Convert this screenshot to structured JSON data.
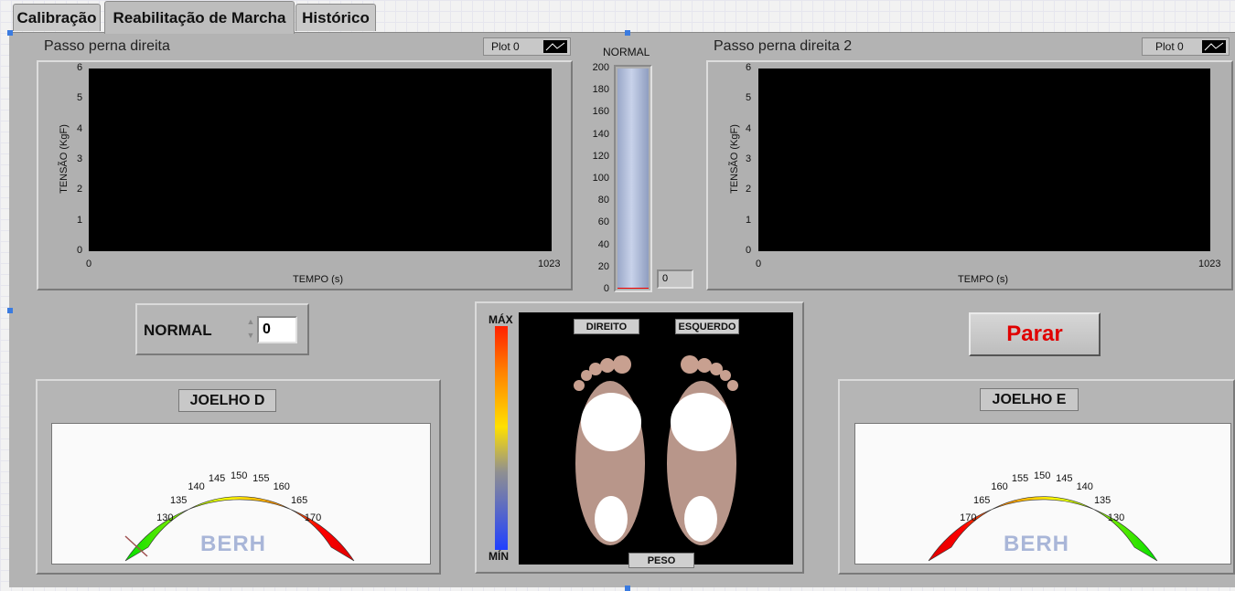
{
  "tabs": [
    {
      "label": "Calibração"
    },
    {
      "label": "Reabilitação de Marcha"
    },
    {
      "label": "Histórico"
    }
  ],
  "chart_left": {
    "title": "Passo perna direita",
    "legend": "Plot 0",
    "ylabel": "TENSÃO (KgF)",
    "xlabel": "TEMPO (s)",
    "y_ticks": [
      "6",
      "5",
      "4",
      "3",
      "2",
      "1",
      "0"
    ],
    "x_ticks": [
      "0",
      "1023"
    ]
  },
  "chart_right": {
    "title": "Passo perna direita 2",
    "legend": "Plot 0",
    "ylabel": "TENSÃO (KgF)",
    "xlabel": "TEMPO (s)",
    "y_ticks": [
      "6",
      "5",
      "4",
      "3",
      "2",
      "1",
      "0"
    ],
    "x_ticks": [
      "0",
      "1023"
    ]
  },
  "chart_data": [
    {
      "type": "line",
      "title": "Passo perna direita",
      "xlabel": "TEMPO (s)",
      "ylabel": "TENSÃO (KgF)",
      "xlim": [
        0,
        1023
      ],
      "ylim": [
        0,
        6
      ],
      "series": []
    },
    {
      "type": "line",
      "title": "Passo perna direita 2",
      "xlabel": "TEMPO (s)",
      "ylabel": "TENSÃO (KgF)",
      "xlim": [
        0,
        1023
      ],
      "ylim": [
        0,
        6
      ],
      "series": []
    }
  ],
  "tank": {
    "label": "NORMAL",
    "scale": [
      "200",
      "180",
      "160",
      "140",
      "120",
      "100",
      "80",
      "60",
      "40",
      "20",
      "0"
    ],
    "value": "0",
    "level": 0
  },
  "numeric": {
    "label": "NORMAL",
    "value": "0"
  },
  "stop_button": {
    "label": "Parar",
    "color": "#e00000"
  },
  "knee_right": {
    "label": "JOELHO D",
    "ticks": [
      "130",
      "135",
      "140",
      "145",
      "150",
      "155",
      "160",
      "165",
      "170"
    ],
    "watermark": "BERH"
  },
  "knee_left": {
    "label": "JOELHO E",
    "ticks": [
      "170",
      "165",
      "160",
      "155",
      "150",
      "145",
      "140",
      "135",
      "130"
    ],
    "watermark": "BERH"
  },
  "pressure_map": {
    "max_label": "MÁX",
    "min_label": "MÍN",
    "right_label": "DIREITO",
    "left_label": "ESQUERDO",
    "weight_label": "PESO"
  }
}
